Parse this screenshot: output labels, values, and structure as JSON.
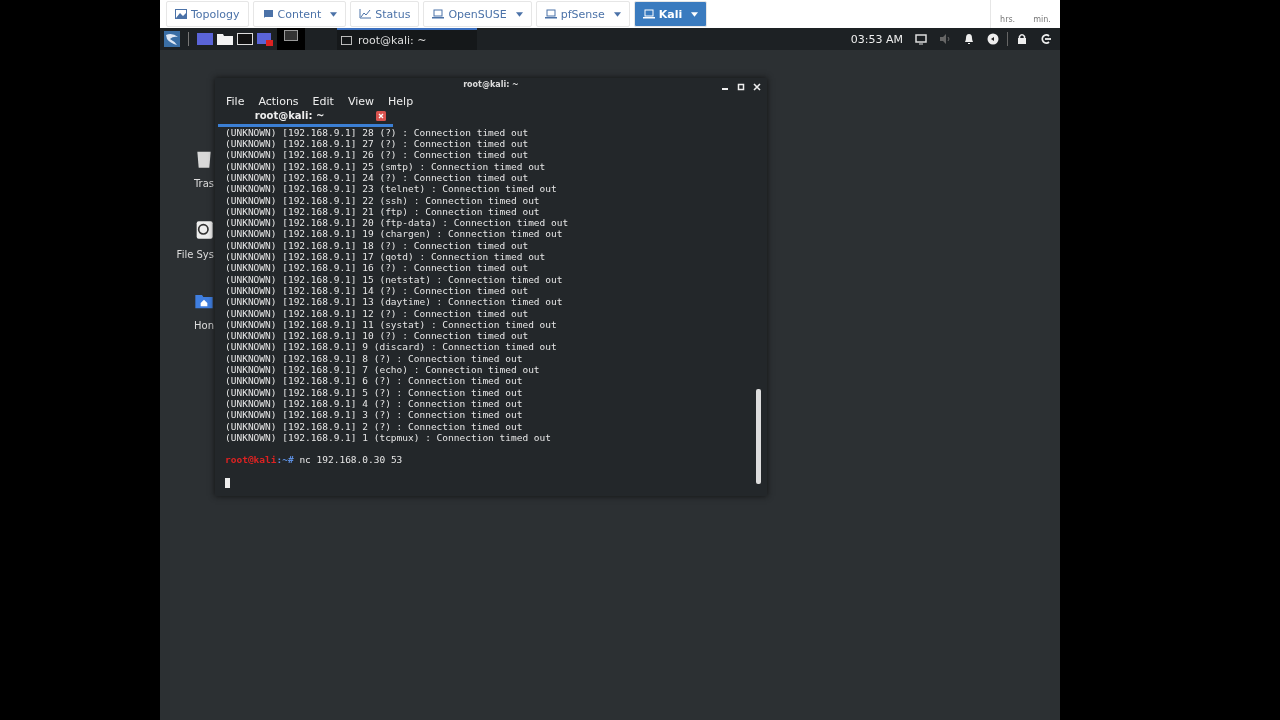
{
  "top_tabs": [
    {
      "label": "Topology",
      "kind": "image",
      "dropdown": false,
      "selected": false
    },
    {
      "label": "Content",
      "kind": "book",
      "dropdown": true,
      "selected": false
    },
    {
      "label": "Status",
      "kind": "chart",
      "dropdown": false,
      "selected": false
    },
    {
      "label": "OpenSUSE",
      "kind": "laptop",
      "dropdown": true,
      "selected": false
    },
    {
      "label": "pfSense",
      "kind": "laptop",
      "dropdown": true,
      "selected": false
    },
    {
      "label": "Kali",
      "kind": "laptop",
      "dropdown": true,
      "selected": true
    }
  ],
  "timer": {
    "hours_label": "hrs.",
    "minutes_label": "min."
  },
  "taskbar": {
    "window_button": "root@kali: ~",
    "clock": "03:53 AM"
  },
  "desktop_icons": [
    {
      "label": "Tras",
      "kind": "trash"
    },
    {
      "label": "File Sys",
      "kind": "drive"
    },
    {
      "label": "Hon",
      "kind": "home"
    }
  ],
  "terminal": {
    "title": "root@kali: ~",
    "menu": [
      "File",
      "Actions",
      "Edit",
      "View",
      "Help"
    ],
    "tab": "root@kali: ~",
    "lines": [
      "(UNKNOWN) [192.168.9.1] 28 (?) : Connection timed out",
      "(UNKNOWN) [192.168.9.1] 27 (?) : Connection timed out",
      "(UNKNOWN) [192.168.9.1] 26 (?) : Connection timed out",
      "(UNKNOWN) [192.168.9.1] 25 (smtp) : Connection timed out",
      "(UNKNOWN) [192.168.9.1] 24 (?) : Connection timed out",
      "(UNKNOWN) [192.168.9.1] 23 (telnet) : Connection timed out",
      "(UNKNOWN) [192.168.9.1] 22 (ssh) : Connection timed out",
      "(UNKNOWN) [192.168.9.1] 21 (ftp) : Connection timed out",
      "(UNKNOWN) [192.168.9.1] 20 (ftp-data) : Connection timed out",
      "(UNKNOWN) [192.168.9.1] 19 (chargen) : Connection timed out",
      "(UNKNOWN) [192.168.9.1] 18 (?) : Connection timed out",
      "(UNKNOWN) [192.168.9.1] 17 (qotd) : Connection timed out",
      "(UNKNOWN) [192.168.9.1] 16 (?) : Connection timed out",
      "(UNKNOWN) [192.168.9.1] 15 (netstat) : Connection timed out",
      "(UNKNOWN) [192.168.9.1] 14 (?) : Connection timed out",
      "(UNKNOWN) [192.168.9.1] 13 (daytime) : Connection timed out",
      "(UNKNOWN) [192.168.9.1] 12 (?) : Connection timed out",
      "(UNKNOWN) [192.168.9.1] 11 (systat) : Connection timed out",
      "(UNKNOWN) [192.168.9.1] 10 (?) : Connection timed out",
      "(UNKNOWN) [192.168.9.1] 9 (discard) : Connection timed out",
      "(UNKNOWN) [192.168.9.1] 8 (?) : Connection timed out",
      "(UNKNOWN) [192.168.9.1] 7 (echo) : Connection timed out",
      "(UNKNOWN) [192.168.9.1] 6 (?) : Connection timed out",
      "(UNKNOWN) [192.168.9.1] 5 (?) : Connection timed out",
      "(UNKNOWN) [192.168.9.1] 4 (?) : Connection timed out",
      "(UNKNOWN) [192.168.9.1] 3 (?) : Connection timed out",
      "(UNKNOWN) [192.168.9.1] 2 (?) : Connection timed out",
      "(UNKNOWN) [192.168.9.1] 1 (tcpmux) : Connection timed out"
    ],
    "prompt_user": "root@kali",
    "prompt_path": ":~#",
    "command": "nc 192.168.0.30 53"
  }
}
